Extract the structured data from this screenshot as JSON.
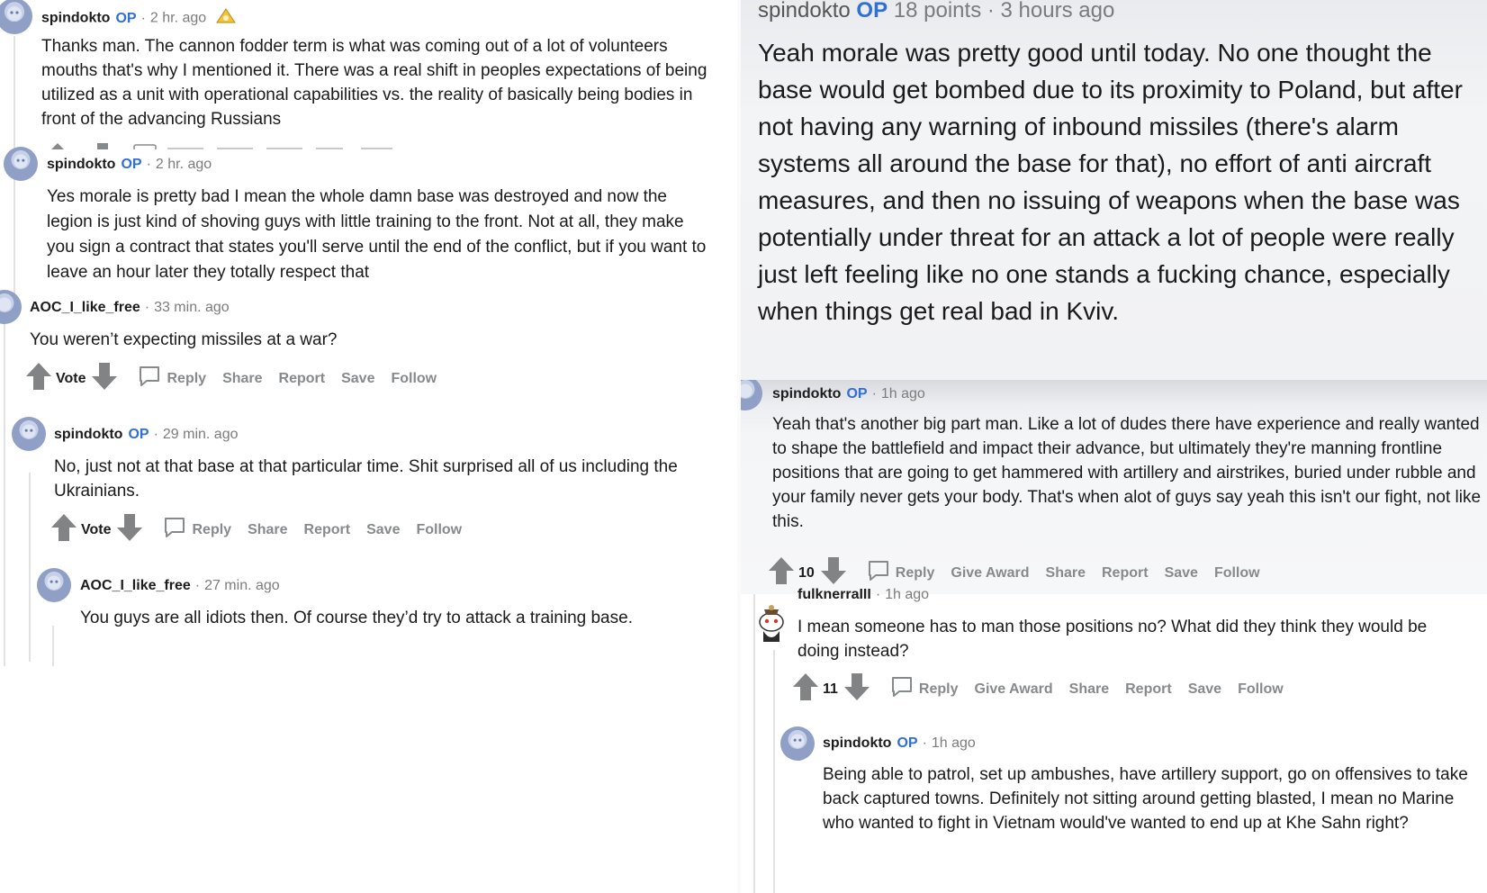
{
  "left_panel": {
    "comments": [
      {
        "username": "spindokto",
        "op_badge": "OP",
        "time": "2 hr. ago",
        "body": "Thanks man. The cannon fodder term is what was coming out of a lot of volunteers mouths that's why I mentioned it. There was a real shift in peoples expectations of being utilized as a unit with operational capabilities vs. the reality of basically being bodies in front of the advancing Russians"
      },
      {
        "username": "spindokto",
        "op_badge": "OP",
        "time": "2 hr. ago",
        "body": "Yes morale is pretty bad I mean the whole damn base was destroyed and now the legion is just kind of shoving guys with little training to the front. Not at all, they make you sign a contract that states you'll serve until the end of the conflict, but if you want to leave an hour later they totally respect that"
      },
      {
        "username": "AOC_I_like_free",
        "time": "33 min. ago",
        "body": "You weren’t expecting missiles at a war?",
        "vote_label": "Vote",
        "actions": [
          "Reply",
          "Share",
          "Report",
          "Save",
          "Follow"
        ]
      },
      {
        "username": "spindokto",
        "op_badge": "OP",
        "time": "29 min. ago",
        "body": "No, just not at that base at that particular time. Shit surprised all of us including the Ukrainians.",
        "vote_label": "Vote",
        "actions": [
          "Reply",
          "Share",
          "Report",
          "Save",
          "Follow"
        ]
      },
      {
        "username": "AOC_I_like_free",
        "time": "27 min. ago",
        "body": "You guys are all idiots then. Of course they’d try to attack a training base."
      }
    ]
  },
  "top_right": {
    "username": "spindokto",
    "op_badge": "OP",
    "points": "18 points",
    "time": "3 hours ago",
    "body": "Yeah morale was pretty good until today. No one thought the base would get bombed due to its proximity to Poland, but after not having any warning of inbound missiles (there's alarm systems all around the base for that), no effort of anti aircraft measures, and then no issuing of weapons when the base was potentially under threat for an attack a lot of people were really just left feeling like no one stands a fucking chance, especially when things get real bad in Kviv."
  },
  "bottom_right": {
    "comments": [
      {
        "username": "spindokto",
        "op_badge": "OP",
        "time": "1h ago",
        "body": "Yeah that's another big part man. Like a lot of dudes there have experience and really wanted to shape the battlefield and impact their advance, but ultimately they're manning frontline positions that are going to get hammered with artillery and airstrikes, buried under rubble and your family never gets your body. That's when alot of guys say yeah this isn't our fight, not like this.",
        "score": "10",
        "actions": [
          "Reply",
          "Give Award",
          "Share",
          "Report",
          "Save",
          "Follow"
        ]
      },
      {
        "username": "fulknerraIII",
        "time": "1h ago",
        "body": "I mean someone has to man those positions no? What did they think they would be doing instead?",
        "score": "11",
        "actions": [
          "Reply",
          "Give Award",
          "Share",
          "Report",
          "Save",
          "Follow"
        ]
      },
      {
        "username": "spindokto",
        "op_badge": "OP",
        "time": "1h ago",
        "body": "Being able to patrol, set up ambushes, have artillery support, go on offensives to take back captured towns. Definitely not sitting around getting blasted, I mean no Marine who wanted to fight in Vietnam would've wanted to end up at Khe Sahn right?"
      }
    ]
  },
  "colors": {
    "op_blue": "#2f6fd6",
    "meta_gray": "#7c7c7c",
    "action_gray": "#878a8c",
    "highlight_bg": "#f1f2f4",
    "avatar_blue": "#8f9fc6"
  },
  "icons": [
    "snoo-avatar-icon",
    "upvote-arrow-icon",
    "downvote-arrow-icon",
    "comment-bubble-icon",
    "award-icon",
    "snoo-costume-avatar-icon"
  ]
}
